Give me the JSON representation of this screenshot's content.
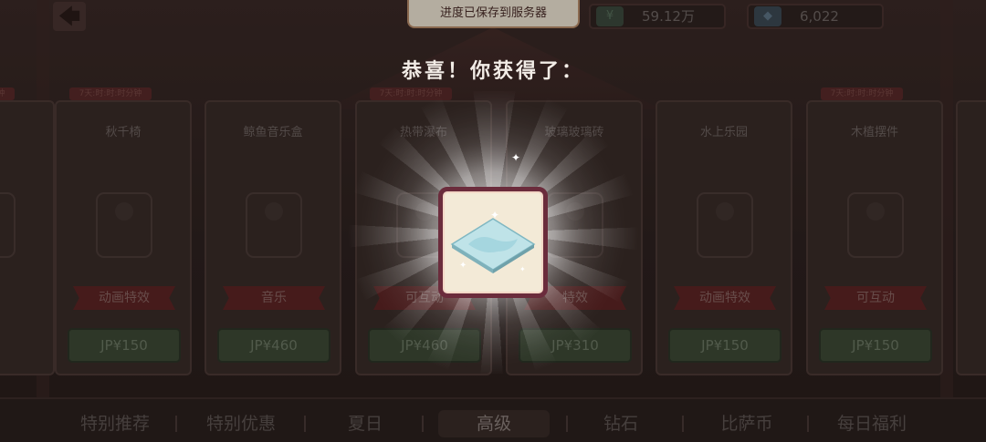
{
  "top_bar": {
    "back_icon": "arrow-left-icon",
    "toast": "进度已保存到服务器",
    "coins": {
      "icon": "cash-icon",
      "value": "59.12万"
    },
    "gems": {
      "icon": "diamond-icon",
      "value": "6,022"
    }
  },
  "popup": {
    "title": "恭喜！你获得了：",
    "reward_icon": "glass-floor-tile-icon"
  },
  "cards": [
    {
      "timer": "7天:时:时:时分钟",
      "name": "",
      "tag": "",
      "price": "",
      "art": "cat-icon"
    },
    {
      "timer": "7天:时:时:时分钟",
      "name": "秋千椅",
      "tag": "动画特效",
      "price": "JP¥150",
      "art": "swing-chair-icon"
    },
    {
      "timer": "",
      "name": "鲸鱼音乐盒",
      "tag": "音乐",
      "price": "JP¥460",
      "art": "whale-music-box-icon"
    },
    {
      "timer": "7天:时:时:时分钟",
      "name": "热带瀑布",
      "tag": "可互动",
      "price": "JP¥460",
      "art": "waterfall-icon"
    },
    {
      "timer": "",
      "name": "玻璃玻璃砖",
      "tag": "特效",
      "price": "JP¥310",
      "art": "glass-tile-icon"
    },
    {
      "timer": "",
      "name": "水上乐园",
      "tag": "动画特效",
      "price": "JP¥150",
      "art": "water-park-icon"
    },
    {
      "timer": "7天:时:时:时分钟",
      "name": "木植摆件",
      "tag": "可互动",
      "price": "JP¥150",
      "art": "wood-planter-icon"
    },
    {
      "timer": "",
      "name": "",
      "tag": "",
      "price": "",
      "art": "partial-card"
    }
  ],
  "tabs": [
    "特别推荐",
    "特别优惠",
    "夏日",
    "高级",
    "钻石",
    "比萨币",
    "每日福利"
  ],
  "active_tab": "高级"
}
